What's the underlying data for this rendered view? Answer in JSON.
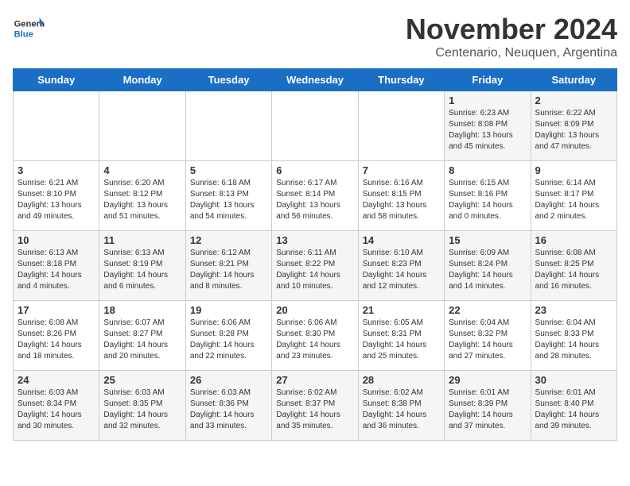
{
  "header": {
    "logo_general": "General",
    "logo_blue": "Blue",
    "month_title": "November 2024",
    "location": "Centenario, Neuquen, Argentina"
  },
  "days_of_week": [
    "Sunday",
    "Monday",
    "Tuesday",
    "Wednesday",
    "Thursday",
    "Friday",
    "Saturday"
  ],
  "weeks": [
    {
      "days": [
        {
          "num": "",
          "info": ""
        },
        {
          "num": "",
          "info": ""
        },
        {
          "num": "",
          "info": ""
        },
        {
          "num": "",
          "info": ""
        },
        {
          "num": "",
          "info": ""
        },
        {
          "num": "1",
          "info": "Sunrise: 6:23 AM\nSunset: 8:08 PM\nDaylight: 13 hours\nand 45 minutes."
        },
        {
          "num": "2",
          "info": "Sunrise: 6:22 AM\nSunset: 8:09 PM\nDaylight: 13 hours\nand 47 minutes."
        }
      ]
    },
    {
      "days": [
        {
          "num": "3",
          "info": "Sunrise: 6:21 AM\nSunset: 8:10 PM\nDaylight: 13 hours\nand 49 minutes."
        },
        {
          "num": "4",
          "info": "Sunrise: 6:20 AM\nSunset: 8:12 PM\nDaylight: 13 hours\nand 51 minutes."
        },
        {
          "num": "5",
          "info": "Sunrise: 6:18 AM\nSunset: 8:13 PM\nDaylight: 13 hours\nand 54 minutes."
        },
        {
          "num": "6",
          "info": "Sunrise: 6:17 AM\nSunset: 8:14 PM\nDaylight: 13 hours\nand 56 minutes."
        },
        {
          "num": "7",
          "info": "Sunrise: 6:16 AM\nSunset: 8:15 PM\nDaylight: 13 hours\nand 58 minutes."
        },
        {
          "num": "8",
          "info": "Sunrise: 6:15 AM\nSunset: 8:16 PM\nDaylight: 14 hours\nand 0 minutes."
        },
        {
          "num": "9",
          "info": "Sunrise: 6:14 AM\nSunset: 8:17 PM\nDaylight: 14 hours\nand 2 minutes."
        }
      ]
    },
    {
      "days": [
        {
          "num": "10",
          "info": "Sunrise: 6:13 AM\nSunset: 8:18 PM\nDaylight: 14 hours\nand 4 minutes."
        },
        {
          "num": "11",
          "info": "Sunrise: 6:13 AM\nSunset: 8:19 PM\nDaylight: 14 hours\nand 6 minutes."
        },
        {
          "num": "12",
          "info": "Sunrise: 6:12 AM\nSunset: 8:21 PM\nDaylight: 14 hours\nand 8 minutes."
        },
        {
          "num": "13",
          "info": "Sunrise: 6:11 AM\nSunset: 8:22 PM\nDaylight: 14 hours\nand 10 minutes."
        },
        {
          "num": "14",
          "info": "Sunrise: 6:10 AM\nSunset: 8:23 PM\nDaylight: 14 hours\nand 12 minutes."
        },
        {
          "num": "15",
          "info": "Sunrise: 6:09 AM\nSunset: 8:24 PM\nDaylight: 14 hours\nand 14 minutes."
        },
        {
          "num": "16",
          "info": "Sunrise: 6:08 AM\nSunset: 8:25 PM\nDaylight: 14 hours\nand 16 minutes."
        }
      ]
    },
    {
      "days": [
        {
          "num": "17",
          "info": "Sunrise: 6:08 AM\nSunset: 8:26 PM\nDaylight: 14 hours\nand 18 minutes."
        },
        {
          "num": "18",
          "info": "Sunrise: 6:07 AM\nSunset: 8:27 PM\nDaylight: 14 hours\nand 20 minutes."
        },
        {
          "num": "19",
          "info": "Sunrise: 6:06 AM\nSunset: 8:28 PM\nDaylight: 14 hours\nand 22 minutes."
        },
        {
          "num": "20",
          "info": "Sunrise: 6:06 AM\nSunset: 8:30 PM\nDaylight: 14 hours\nand 23 minutes."
        },
        {
          "num": "21",
          "info": "Sunrise: 6:05 AM\nSunset: 8:31 PM\nDaylight: 14 hours\nand 25 minutes."
        },
        {
          "num": "22",
          "info": "Sunrise: 6:04 AM\nSunset: 8:32 PM\nDaylight: 14 hours\nand 27 minutes."
        },
        {
          "num": "23",
          "info": "Sunrise: 6:04 AM\nSunset: 8:33 PM\nDaylight: 14 hours\nand 28 minutes."
        }
      ]
    },
    {
      "days": [
        {
          "num": "24",
          "info": "Sunrise: 6:03 AM\nSunset: 8:34 PM\nDaylight: 14 hours\nand 30 minutes."
        },
        {
          "num": "25",
          "info": "Sunrise: 6:03 AM\nSunset: 8:35 PM\nDaylight: 14 hours\nand 32 minutes."
        },
        {
          "num": "26",
          "info": "Sunrise: 6:03 AM\nSunset: 8:36 PM\nDaylight: 14 hours\nand 33 minutes."
        },
        {
          "num": "27",
          "info": "Sunrise: 6:02 AM\nSunset: 8:37 PM\nDaylight: 14 hours\nand 35 minutes."
        },
        {
          "num": "28",
          "info": "Sunrise: 6:02 AM\nSunset: 8:38 PM\nDaylight: 14 hours\nand 36 minutes."
        },
        {
          "num": "29",
          "info": "Sunrise: 6:01 AM\nSunset: 8:39 PM\nDaylight: 14 hours\nand 37 minutes."
        },
        {
          "num": "30",
          "info": "Sunrise: 6:01 AM\nSunset: 8:40 PM\nDaylight: 14 hours\nand 39 minutes."
        }
      ]
    }
  ]
}
